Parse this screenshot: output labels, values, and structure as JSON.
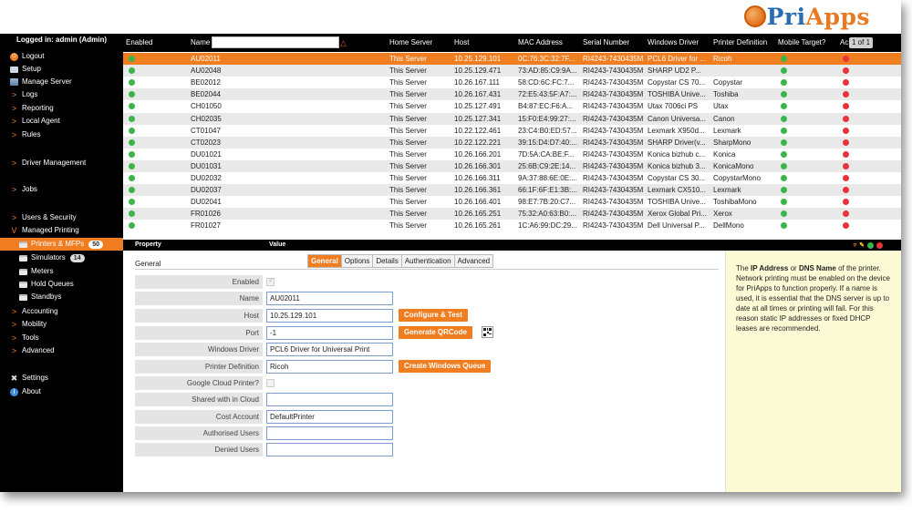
{
  "logo": {
    "pri": "Pri",
    "apps": "Apps"
  },
  "sidebar": {
    "user": "Logged in: admin (Admin)",
    "items": [
      {
        "label": "Logout",
        "icon": "power-icon"
      },
      {
        "label": "Setup",
        "icon": "setup-icon"
      },
      {
        "label": "Manage Server",
        "icon": "server-icon"
      },
      {
        "label": "Logs",
        "icon": "chevron-right-icon"
      },
      {
        "label": "Reporting",
        "icon": "chevron-right-icon"
      },
      {
        "label": "Local Agent",
        "icon": "chevron-right-icon"
      },
      {
        "label": "Rules",
        "icon": "chevron-right-icon"
      },
      {
        "label": "Driver Management",
        "icon": "chevron-right-icon"
      },
      {
        "label": "Jobs",
        "icon": "chevron-right-icon"
      },
      {
        "label": "Users & Security",
        "icon": "chevron-right-icon"
      },
      {
        "label": "Managed Printing",
        "icon": "chevron-down-icon"
      },
      {
        "label": "Printers & MFPs",
        "icon": "printer-icon",
        "badge": "50"
      },
      {
        "label": "Simulators",
        "icon": "printer-icon",
        "badge": "14"
      },
      {
        "label": "Meters",
        "icon": "printer-icon"
      },
      {
        "label": "Hold Queues",
        "icon": "printer-icon"
      },
      {
        "label": "Standbys",
        "icon": "printer-icon"
      },
      {
        "label": "Accounting",
        "icon": "chevron-right-icon"
      },
      {
        "label": "Mobility",
        "icon": "chevron-right-icon"
      },
      {
        "label": "Tools",
        "icon": "chevron-right-icon"
      },
      {
        "label": "Advanced",
        "icon": "chevron-right-icon"
      },
      {
        "label": "Settings",
        "icon": "settings-icon"
      },
      {
        "label": "About",
        "icon": "info-icon"
      }
    ]
  },
  "grid": {
    "columns": [
      "Enabled",
      "Name",
      "Home Server",
      "Host",
      "MAC Address",
      "Serial Number",
      "Windows Driver",
      "Printer Definition",
      "Mobile Target?",
      "Ac"
    ],
    "pager": "1 of 1",
    "rows": [
      {
        "name": "AU02011",
        "server": "This Server",
        "host": "10.25.129.101",
        "mac": "0C:76:3C:32:7F...",
        "serial": "RI4243-7430435M",
        "driver": "PCL6 Driver for ...",
        "def": "Ricoh",
        "mobile": true,
        "ac": false
      },
      {
        "name": "AU02048",
        "server": "This Server",
        "host": "10.25.129.471",
        "mac": "73:AD:85:C9:9A...",
        "serial": "RI4243-7430435M",
        "driver": "SHARP UD2 P...",
        "def": "",
        "mobile": true,
        "ac": false
      },
      {
        "name": "BE02012",
        "server": "This Server",
        "host": "10.26.167.111",
        "mac": "58:CD:6C:FC:7...",
        "serial": "RI4243-7430435M",
        "driver": "Copystar CS 70...",
        "def": "Copystar",
        "mobile": true,
        "ac": false
      },
      {
        "name": "BE02044",
        "server": "This Server",
        "host": "10.26.167.431",
        "mac": "72:E5:43:5F:A7:...",
        "serial": "RI4243-7430435M",
        "driver": "TOSHIBA Unive...",
        "def": "Toshiba",
        "mobile": true,
        "ac": false
      },
      {
        "name": "CH01050",
        "server": "This Server",
        "host": "10.25.127.491",
        "mac": "B4:87:EC:F6:A...",
        "serial": "RI4243-7430435M",
        "driver": "Utax 7006ci PS",
        "def": "Utax",
        "mobile": true,
        "ac": false
      },
      {
        "name": "CH02035",
        "server": "This Server",
        "host": "10.25.127.341",
        "mac": "15:F0:E4:99:27:...",
        "serial": "RI4243-7430435M",
        "driver": "Canon Universa...",
        "def": "Canon",
        "mobile": true,
        "ac": false
      },
      {
        "name": "CT01047",
        "server": "This Server",
        "host": "10.22.122.461",
        "mac": "23:C4:B0:ED:57...",
        "serial": "RI4243-7430435M",
        "driver": "Lexmark X950d...",
        "def": "Lexmark",
        "mobile": true,
        "ac": false
      },
      {
        "name": "CT02023",
        "server": "This Server",
        "host": "10.22.122.221",
        "mac": "39:15:D4:D7:40:...",
        "serial": "RI4243-7430435M",
        "driver": "SHARP Driver(v...",
        "def": "SharpMono",
        "mobile": true,
        "ac": false
      },
      {
        "name": "DU01021",
        "server": "This Server",
        "host": "10.26.166.201",
        "mac": "7D:5A:CA:BE:F...",
        "serial": "RI4243-7430435M",
        "driver": "Konica bizhub c...",
        "def": "Konica",
        "mobile": true,
        "ac": false
      },
      {
        "name": "DU01031",
        "server": "This Server",
        "host": "10.26.166.301",
        "mac": "25:6B:C9:2E:14...",
        "serial": "RI4243-7430435M",
        "driver": "Konica bizhub 3...",
        "def": "KonicaMono",
        "mobile": true,
        "ac": false
      },
      {
        "name": "DU02032",
        "server": "This Server",
        "host": "10.26.166.311",
        "mac": "9A:37:88:6E:0E:...",
        "serial": "RI4243-7430435M",
        "driver": "Copystar CS 30...",
        "def": "CopystarMono",
        "mobile": true,
        "ac": false
      },
      {
        "name": "DU02037",
        "server": "This Server",
        "host": "10.26.166.361",
        "mac": "66:1F:6F:E1:3B:...",
        "serial": "RI4243-7430435M",
        "driver": "Lexmark CX510...",
        "def": "Lexmark",
        "mobile": true,
        "ac": false
      },
      {
        "name": "DU02041",
        "server": "This Server",
        "host": "10.26.166.401",
        "mac": "98:E7:7B:20:C7...",
        "serial": "RI4243-7430435M",
        "driver": "TOSHIBA Unive...",
        "def": "ToshibaMono",
        "mobile": true,
        "ac": false
      },
      {
        "name": "FR01026",
        "server": "This Server",
        "host": "10.26.165.251",
        "mac": "75:32:A0:63:B0:...",
        "serial": "RI4243-7430435M",
        "driver": "Xerox Global Pri...",
        "def": "Xerox",
        "mobile": true,
        "ac": false
      },
      {
        "name": "FR01027",
        "server": "This Server",
        "host": "10.26.165.261",
        "mac": "1C:A6:99:DC:29...",
        "serial": "RI4243-7430435M",
        "driver": "Dell Universal P...",
        "def": "DellMono",
        "mobile": true,
        "ac": false
      }
    ]
  },
  "detail": {
    "col_property": "Property",
    "col_value": "Value",
    "section": "General",
    "tabs": [
      "General",
      "Options",
      "Details",
      "Authentication",
      "Advanced"
    ],
    "fields": {
      "enabled": "Enabled",
      "name": "Name",
      "name_value": "AU02011",
      "host": "Host",
      "host_value": "10.25.129.101",
      "port": "Port",
      "port_value": "-1",
      "driver": "Windows Driver",
      "driver_value": "PCL6 Driver for Universal Print",
      "def": "Printer Definition",
      "def_value": "Ricoh",
      "gcp": "Google Cloud Printer?",
      "shared": "Shared with in Cloud",
      "shared_value": "",
      "cost": "Cost Account",
      "cost_value": "DefaultPrinter",
      "auth_users": "Authorised Users",
      "auth_users_value": "",
      "denied_users": "Denied Users",
      "denied_users_value": ""
    },
    "buttons": {
      "configure": "Configure & Test",
      "qrcode": "Generate QRCode",
      "queue": "Create Windows Queue"
    }
  },
  "help": {
    "t1": "The ",
    "b1": "IP Address",
    "t2": " or ",
    "b2": "DNS Name",
    "t3": " of the printer. Network printing must be enabled on the device for PriApps to function properly. If a name is used, it is essential that the DNS server is up to date at all times or printing will fail. For this reason static IP addresses or fixed DHCP leases are recommended."
  },
  "colors": {
    "accent": "#f07d1f",
    "ok": "#3bb54a",
    "no": "#e8333a"
  }
}
